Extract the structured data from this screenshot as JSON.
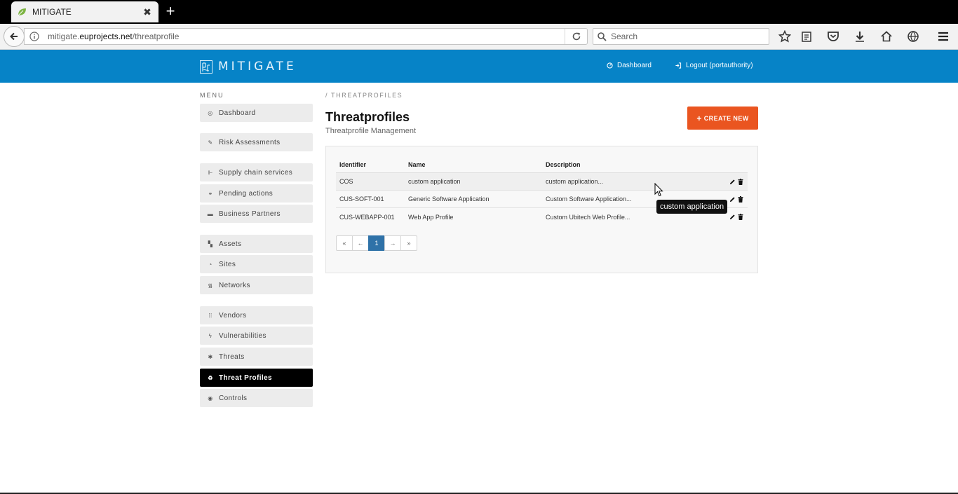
{
  "browser": {
    "tab_title": "MITIGATE",
    "tab_close": "✖",
    "new_tab": "+",
    "url_host": "mitigate.",
    "url_domain": "euprojects.net",
    "url_path": "/threatprofile",
    "search_placeholder": "Search"
  },
  "header": {
    "brand": "MITIGATE",
    "dashboard_link": "Dashboard",
    "logout_link": "Logout (portauthority)"
  },
  "sidebar": {
    "menu_label": "MENU",
    "items": [
      {
        "label": "Dashboard",
        "icon": "dashboard-icon",
        "glyph": "◎"
      },
      {
        "label": "Risk Assessments",
        "icon": "wrench-icon",
        "glyph": "✎"
      },
      {
        "label": "Supply chain services",
        "icon": "supply-chain-icon",
        "glyph": "⊩"
      },
      {
        "label": "Pending actions",
        "icon": "link-icon",
        "glyph": "⚭"
      },
      {
        "label": "Business Partners",
        "icon": "briefcase-icon",
        "glyph": "▬"
      },
      {
        "label": "Assets",
        "icon": "assets-icon",
        "glyph": "▚"
      },
      {
        "label": "Sites",
        "icon": "globe-icon",
        "glyph": "◔"
      },
      {
        "label": "Networks",
        "icon": "wifi-icon",
        "glyph": "᯾"
      },
      {
        "label": "Vendors",
        "icon": "grid-icon",
        "glyph": "⁞⁞"
      },
      {
        "label": "Vulnerabilities",
        "icon": "bolt-icon",
        "glyph": "ϟ"
      },
      {
        "label": "Threats",
        "icon": "bug-icon",
        "glyph": "✱"
      },
      {
        "label": "Threat Profiles",
        "icon": "recycle-icon",
        "glyph": "♻"
      },
      {
        "label": "Controls",
        "icon": "eye-icon",
        "glyph": "◉"
      }
    ]
  },
  "main": {
    "breadcrumb": "/ THREATPROFILES",
    "title": "Threatprofiles",
    "subtitle": "Threatprofile Management",
    "create_button": "CREATE NEW",
    "create_plus": "+",
    "table": {
      "headers": [
        "Identifier",
        "Name",
        "Description"
      ],
      "rows": [
        {
          "identifier": "COS",
          "name": "custom application",
          "description": "custom application..."
        },
        {
          "identifier": "CUS-SOFT-001",
          "name": "Generic Software Application",
          "description": "Custom Software Application..."
        },
        {
          "identifier": "CUS-WEBAPP-001",
          "name": "Web App Profile",
          "description": "Custom Ubitech Web Profile..."
        }
      ]
    },
    "pagination": {
      "first": "«",
      "prev": "←",
      "current": "1",
      "next": "→",
      "last": "»"
    },
    "tooltip": "custom application"
  },
  "colors": {
    "header_blue": "#0683c7",
    "create_orange": "#ea5520",
    "active_black": "#000000",
    "pager_active": "#2f72a8"
  }
}
